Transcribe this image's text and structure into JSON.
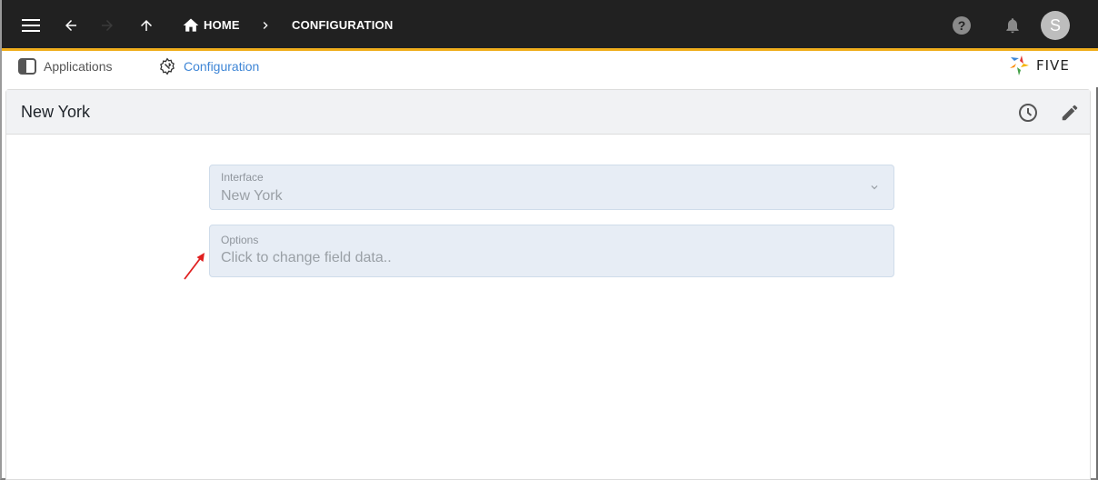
{
  "appbar": {
    "menu_icon": "menu-icon",
    "back_icon": "arrow-left-icon",
    "forward_icon": "arrow-right-icon",
    "up_icon": "arrow-up-icon",
    "breadcrumb": [
      {
        "label": "HOME",
        "icon": "home-icon"
      },
      {
        "label": "CONFIGURATION"
      }
    ],
    "breadcrumb_separator_icon": "chevron-right-icon",
    "help_icon": "help-circle-icon",
    "notifications_icon": "bell-icon",
    "avatar_initial": "S",
    "accent_color": "#f0ae1c"
  },
  "tabs": [
    {
      "label": "Applications",
      "icon": "applications-icon",
      "active": false
    },
    {
      "label": "Configuration",
      "icon": "configuration-gear-wrench-icon",
      "active": true
    }
  ],
  "logo": {
    "text": "FIVE"
  },
  "panel": {
    "title": "New York",
    "actions": [
      {
        "name": "history",
        "icon": "clock-icon"
      },
      {
        "name": "edit",
        "icon": "pencil-icon"
      }
    ]
  },
  "form": {
    "fields": [
      {
        "label": "Interface",
        "value": "New York",
        "type": "select"
      },
      {
        "label": "Options",
        "value": "Click to change field data..",
        "type": "clickable"
      }
    ]
  },
  "annotation": {
    "type": "arrow",
    "color": "#e02020",
    "points_to": "Options field"
  }
}
